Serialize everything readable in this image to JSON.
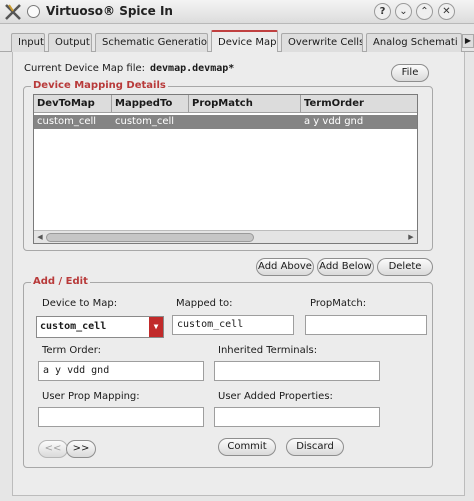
{
  "window": {
    "title": "Virtuoso® Spice In"
  },
  "tabs": [
    {
      "label": "Input"
    },
    {
      "label": "Output"
    },
    {
      "label": "Schematic Generation"
    },
    {
      "label": "Device Map",
      "active": true
    },
    {
      "label": "Overwrite Cells"
    },
    {
      "label": "Analog Schemati"
    }
  ],
  "device_map": {
    "file_label": "Current Device Map file:",
    "file_value": "devmap.devmap*",
    "file_button": "File"
  },
  "mapping_details": {
    "title": "Device Mapping Details",
    "columns": [
      "DevToMap",
      "MappedTo",
      "PropMatch",
      "TermOrder"
    ],
    "rows": [
      [
        "custom_cell",
        "custom_cell",
        "",
        "a y vdd gnd"
      ]
    ]
  },
  "actions": {
    "add_above": "Add Above",
    "add_below": "Add Below",
    "delete": "Delete"
  },
  "add_edit": {
    "title": "Add / Edit",
    "device_to_map_label": "Device to Map:",
    "device_to_map_value": "custom_cell",
    "mapped_to_label": "Mapped to:",
    "mapped_to_value": "custom_cell",
    "prop_match_label": "PropMatch:",
    "prop_match_value": "",
    "term_order_label": "Term Order:",
    "term_order_value": "a y vdd gnd",
    "inherited_terminals_label": "Inherited Terminals:",
    "inherited_terminals_value": "",
    "user_prop_mapping_label": "User Prop Mapping:",
    "user_prop_mapping_value": "",
    "user_added_properties_label": "User Added Properties:",
    "user_added_properties_value": "",
    "prev_button": "<<",
    "next_button": ">>",
    "commit_button": "Commit",
    "discard_button": "Discard"
  },
  "colors": {
    "accent": "#b83a3a",
    "selection": "#848484"
  }
}
